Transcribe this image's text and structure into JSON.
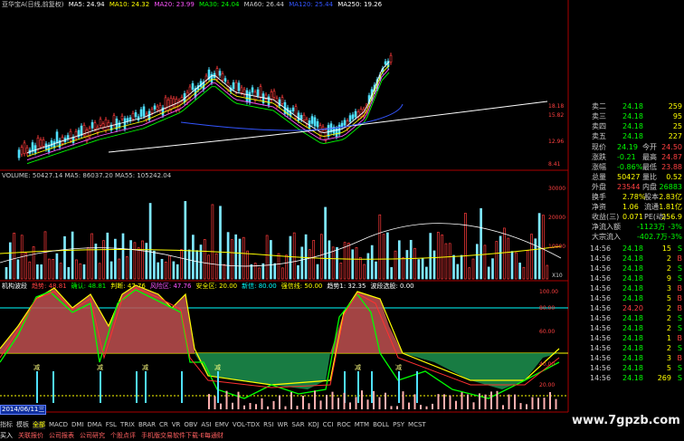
{
  "colors": {
    "up": "#ff3b3b",
    "down": "#4fe0ff",
    "green_line": "#00ff00",
    "white_line": "#ffffff",
    "yellow_line": "#ffff00",
    "magenta_line": "#ff55ff",
    "blue_line": "#3355ff",
    "axis_red": "#aa0000",
    "label_red": "#ff4040"
  },
  "main_chart": {
    "title": "亚华宝A(日线,前复权)",
    "ma": [
      {
        "label": "MA5: 24.94",
        "color": "#ffffff"
      },
      {
        "label": "MA10: 24.32",
        "color": "#ffff00"
      },
      {
        "label": "MA20: 23.99",
        "color": "#ff55ff"
      },
      {
        "label": "MA30: 24.04",
        "color": "#00ff00"
      },
      {
        "label": "MA60: 26.44",
        "color": "#cccccc"
      },
      {
        "label": "MA120: 25.44",
        "color": "#3355ff"
      },
      {
        "label": "MA250: 19.26",
        "color": "#ffffff"
      }
    ],
    "axis": [
      "18.18",
      "15.82",
      "12.96",
      "8.41"
    ]
  },
  "volume_chart": {
    "label": "VOLUME: 50427.14  MA5: 86037.20  MA55: 105242.04",
    "axis": [
      "30000",
      "20000",
      "10000"
    ],
    "unit": "X10"
  },
  "indicator": {
    "items": [
      {
        "label": "机构波段",
        "color": "#ffffff"
      },
      {
        "label": "趋势: 48.81",
        "color": "#ff4040"
      },
      {
        "label": "确认: 48.81",
        "color": "#00ff00"
      },
      {
        "label": "判断: 47.76",
        "color": "#ffff00"
      },
      {
        "label": "风险区: 47.76",
        "color": "#ff55ff"
      },
      {
        "label": "安全区: 20.00",
        "color": "#ffff00"
      },
      {
        "label": "新信: 80.00",
        "color": "#00ffff"
      },
      {
        "label": "强信线: 50.00",
        "color": "#ffff00"
      },
      {
        "label": "趋势1: 32.35",
        "color": "#ffffff"
      },
      {
        "label": "波段选股: 0.00",
        "color": "#ffffff"
      }
    ],
    "axis": [
      "100.00",
      "80.00",
      "60.00",
      "40.00",
      "20.00"
    ],
    "cursor_date": "2014/06/11三",
    "reduce_marker": "减"
  },
  "bottom": {
    "tabs": [
      "指标",
      "模板",
      "全部",
      "MACD",
      "DMI",
      "DMA",
      "FSL",
      "TRIX",
      "BRAR",
      "CR",
      "VR",
      "OBV",
      "ASI",
      "EMV",
      "VOL-TDX",
      "RSI",
      "WR",
      "SAR",
      "KDJ",
      "CCI",
      "ROC",
      "MTM",
      "BOLL",
      "PSY",
      "MCST"
    ],
    "status": [
      "买入",
      "关联报价",
      "公司报表",
      "公司研究",
      "个股点评",
      "手机版交易软件下载-E每通财"
    ],
    "watermark": "www.7gpzb.com"
  },
  "quote": {
    "asks": [
      {
        "label": "卖二",
        "price": "24.18",
        "vol": "259"
      },
      {
        "label": "卖三",
        "price": "24.18",
        "vol": "95"
      },
      {
        "label": "卖四",
        "price": "24.18",
        "vol": "25"
      },
      {
        "label": "卖五",
        "price": "24.18",
        "vol": "227"
      }
    ],
    "stats": [
      {
        "l1": "现价",
        "v1": "24.19",
        "l2": "今开",
        "v2": "24.50"
      },
      {
        "l1": "涨跌",
        "v1": "-0.21",
        "l2": "最高",
        "v2": "24.87"
      },
      {
        "l1": "涨幅",
        "v1": "-0.86%",
        "l2": "最低",
        "v2": "23.88"
      },
      {
        "l1": "总量",
        "v1": "50427",
        "l2": "量比",
        "v2": "0.52"
      },
      {
        "l1": "外盘",
        "v1": "23544",
        "l2": "内盘",
        "v2": "26883"
      }
    ],
    "fund": [
      {
        "l1": "换手",
        "v1": "2.78%",
        "l2": "股本",
        "v2": "2.83亿"
      },
      {
        "l1": "净资",
        "v1": "1.06",
        "l2": "流通",
        "v2": "1.81亿"
      },
      {
        "l1": "收益(三)",
        "v1": "0.071",
        "l2": "PE(动)",
        "v2": "256.9"
      }
    ],
    "flows": [
      {
        "label": "净流入额",
        "value": "-1123万",
        "pct": "-3%"
      },
      {
        "label": "大宗流入",
        "value": "-402.7万",
        "pct": "-3%"
      }
    ],
    "ticks": [
      {
        "time": "14:56",
        "price": "24.18",
        "vol": "15",
        "side": "S"
      },
      {
        "time": "14:56",
        "price": "24.18",
        "vol": "2",
        "side": "B"
      },
      {
        "time": "14:56",
        "price": "24.18",
        "vol": "2",
        "side": "S"
      },
      {
        "time": "14:56",
        "price": "24.18",
        "vol": "9",
        "side": "S"
      },
      {
        "time": "14:56",
        "price": "24.18",
        "vol": "3",
        "side": "B"
      },
      {
        "time": "14:56",
        "price": "24.18",
        "vol": "5",
        "side": "B"
      },
      {
        "time": "14:56",
        "price": "24.20",
        "vol": "2",
        "side": "B"
      },
      {
        "time": "14:56",
        "price": "24.18",
        "vol": "2",
        "side": "S"
      },
      {
        "time": "14:56",
        "price": "24.18",
        "vol": "2",
        "side": "S"
      },
      {
        "time": "14:56",
        "price": "24.18",
        "vol": "1",
        "side": "B"
      },
      {
        "time": "14:56",
        "price": "24.18",
        "vol": "2",
        "side": "S"
      },
      {
        "time": "14:56",
        "price": "24.18",
        "vol": "3",
        "side": "B"
      },
      {
        "time": "14:56",
        "price": "24.18",
        "vol": "5",
        "side": "S"
      },
      {
        "time": "14:56",
        "price": "24.18",
        "vol": "269",
        "side": "S"
      }
    ]
  }
}
